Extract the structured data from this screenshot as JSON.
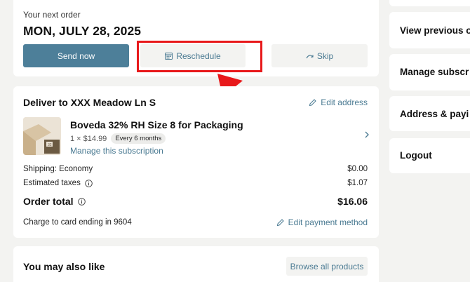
{
  "next_order": {
    "label": "Your next order",
    "date": "MON, JULY 28, 2025",
    "send_now": "Send now",
    "reschedule": "Reschedule",
    "skip": "Skip"
  },
  "delivery": {
    "title": "Deliver to XXX Meadow Ln S",
    "edit_address": "Edit address",
    "product": {
      "name": "Boveda 32% RH Size 8 for Packaging",
      "price": "1 × $14.99",
      "frequency": "Every 6 months",
      "manage": "Manage this subscription",
      "image_text": "32"
    },
    "shipping_label": "Shipping: Economy",
    "shipping_value": "$0.00",
    "taxes_label": "Estimated taxes",
    "taxes_value": "$1.07",
    "total_label": "Order total",
    "total_value": "$16.06",
    "charge_label": "Charge to card ending in 9604",
    "edit_payment": "Edit payment method"
  },
  "also_like": {
    "title": "You may also like",
    "browse": "Browse all products"
  },
  "sidebar": {
    "items": [
      {
        "label": "View previous o"
      },
      {
        "label": "Manage subscr"
      },
      {
        "label": "Address & payi"
      },
      {
        "label": "Logout"
      }
    ]
  },
  "colors": {
    "primary": "#4d7f99",
    "link": "#4a7a92",
    "highlight": "#e8191b",
    "background": "#f3f3f1"
  }
}
